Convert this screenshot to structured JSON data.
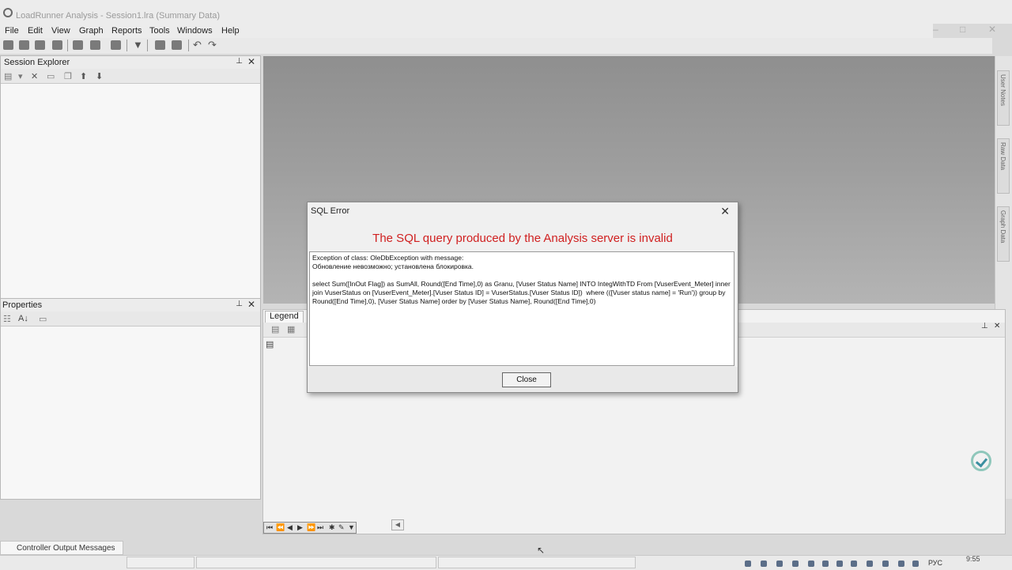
{
  "window": {
    "title": "LoadRunner Analysis - Session1.lra (Summary Data)"
  },
  "menu": [
    "File",
    "Edit",
    "View",
    "Graph",
    "Reports",
    "Tools",
    "Windows",
    "Help"
  ],
  "session_explorer": {
    "title": "Session Explorer"
  },
  "properties": {
    "title": "Properties"
  },
  "legend": {
    "title": "Legend"
  },
  "right_tabs": [
    "User Notes",
    "Raw Data",
    "Graph Data"
  ],
  "bottom_tab": {
    "label": "Controller Output Messages"
  },
  "tray": {
    "lang": "РУС",
    "time": "9:55"
  },
  "dialog": {
    "title": "SQL Error",
    "heading": "The SQL query produced by the Analysis server is invalid",
    "line1": "Exception of class: OleDbException with message:",
    "line2": "Обновление невозможно; установлена блокировка.",
    "query": "select Sum([InOut Flag]) as SumAll, Round([End Time],0) as Granu, [Vuser Status Name] INTO IntegWithTD From [VuserEvent_Meter] inner join VuserStatus on [VuserEvent_Meter].[Vuser Status ID] = VuserStatus.[Vuser Status ID])  where (([Vuser status name] = 'Run')) group by Round([End Time],0), [Vuser Status Name] order by [Vuser Status Name], Round([End Time],0)",
    "close_label": "Close"
  }
}
